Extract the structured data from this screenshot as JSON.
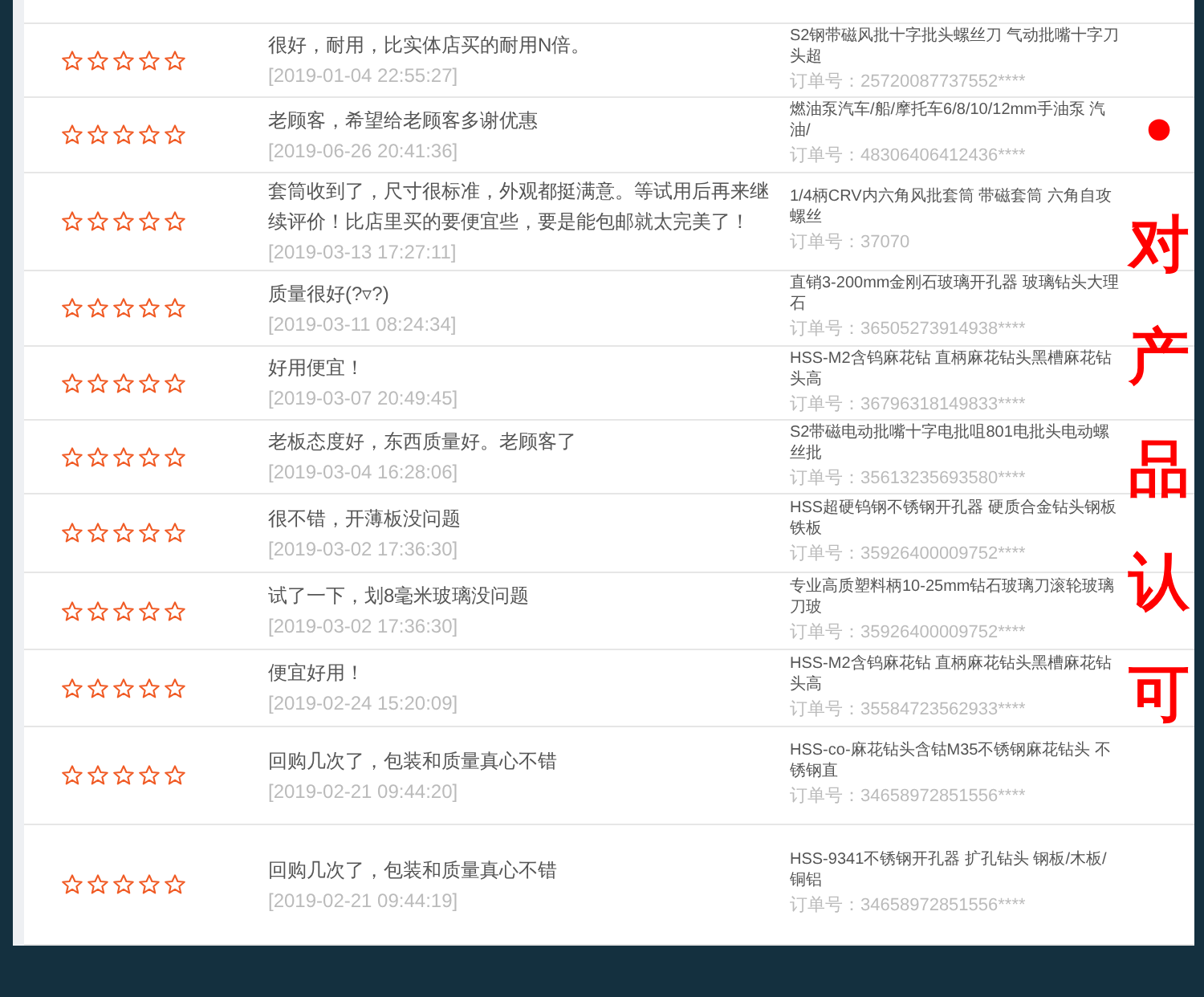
{
  "reviews": [
    {
      "comment": "很好，耐用，比实体店买的耐用N倍。",
      "date": "[2019-01-04 22:55:27]",
      "product": "S2钢带磁风批十字批头螺丝刀 气动批嘴十字刀头超",
      "order": "订单号：25720087737552****"
    },
    {
      "comment": "老顾客，希望给老顾客多谢优惠",
      "date": "[2019-06-26 20:41:36]",
      "product": "燃油泵汽车/船/摩托车6/8/10/12mm手油泵 汽油/",
      "order": "订单号：48306406412436****"
    },
    {
      "comment": "套筒收到了，尺寸很标准，外观都挺满意。等试用后再来继续评价！比店里买的要便宜些，要是能包邮就太完美了！",
      "date": "[2019-03-13 17:27:11]",
      "product": "1/4柄CRV内六角风批套筒 带磁套筒 六角自攻螺丝",
      "order": "订单号：37070"
    },
    {
      "comment": "质量很好(?▿?)",
      "date": "[2019-03-11 08:24:34]",
      "product": "直销3-200mm金刚石玻璃开孔器 玻璃钻头大理石",
      "order": "订单号：36505273914938****"
    },
    {
      "comment": "好用便宜！",
      "date": "[2019-03-07 20:49:45]",
      "product": "HSS-M2含钨麻花钻 直柄麻花钻头黑槽麻花钻头高",
      "order": "订单号：36796318149833****"
    },
    {
      "comment": "老板态度好，东西质量好。老顾客了",
      "date": "[2019-03-04 16:28:06]",
      "product": "S2带磁电动批嘴十字电批咀801电批头电动螺丝批",
      "order": "订单号：35613235693580****"
    },
    {
      "comment": "很不错，开薄板没问题",
      "date": "[2019-03-02 17:36:30]",
      "product": "HSS超硬钨钢不锈钢开孔器 硬质合金钻头钢板铁板",
      "order": "订单号：35926400009752****"
    },
    {
      "comment": "试了一下，划8毫米玻璃没问题",
      "date": "[2019-03-02 17:36:30]",
      "product": "专业高质塑料柄10-25mm钻石玻璃刀滚轮玻璃刀玻",
      "order": "订单号：35926400009752****"
    },
    {
      "comment": "便宜好用！",
      "date": "[2019-02-24 15:20:09]",
      "product": "HSS-M2含钨麻花钻 直柄麻花钻头黑槽麻花钻头高",
      "order": "订单号：35584723562933****"
    },
    {
      "comment": "回购几次了，包装和质量真心不错",
      "date": "[2019-02-21 09:44:20]",
      "product": "HSS-co-麻花钻头含钴M35不锈钢麻花钻头 不锈钢直",
      "order": "订单号：34658972851556****"
    },
    {
      "comment": "回购几次了，包装和质量真心不错",
      "date": "[2019-02-21 09:44:19]",
      "product": "HSS-9341不锈钢开孔器 扩孔钻头 钢板/木板/铜铝",
      "order": "订单号：34658972851556****"
    }
  ],
  "overlay": [
    "•",
    "对",
    "产",
    "品",
    "认",
    "可"
  ]
}
